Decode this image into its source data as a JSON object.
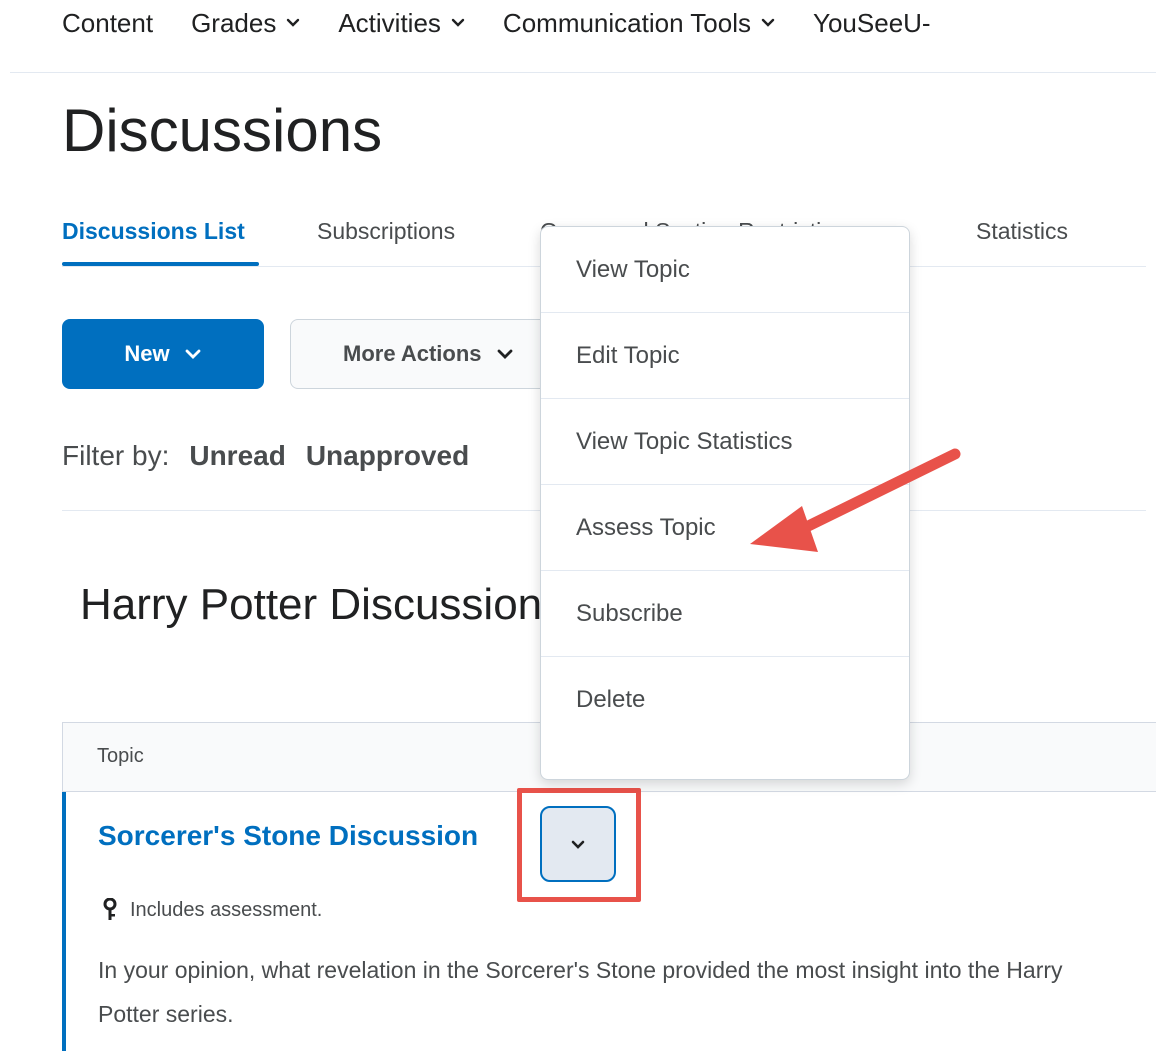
{
  "nav": {
    "items": [
      {
        "label": "Content",
        "dropdown": false
      },
      {
        "label": "Grades",
        "dropdown": true
      },
      {
        "label": "Activities",
        "dropdown": true
      },
      {
        "label": "Communication Tools",
        "dropdown": true
      },
      {
        "label": "YouSeeU-",
        "dropdown": false
      }
    ]
  },
  "page": {
    "title": "Discussions"
  },
  "tabs": [
    {
      "label": "Discussions List",
      "active": true
    },
    {
      "label": "Subscriptions",
      "active": false
    },
    {
      "label": "Group and Section Restrictions",
      "active": false
    },
    {
      "label": "Statistics",
      "active": false
    }
  ],
  "toolbar": {
    "new_label": "New",
    "more_actions_label": "More Actions"
  },
  "filter": {
    "label": "Filter by:",
    "options": [
      "Unread",
      "Unapproved"
    ]
  },
  "forum": {
    "title": "Harry Potter Discussions"
  },
  "table": {
    "column_header": "Topic"
  },
  "topic": {
    "title": "Sorcerer's Stone Discussion",
    "assessment_note": "Includes assessment.",
    "description": "In your opinion, what revelation in the Sorcerer's Stone provided the most insight into the Harry Potter series."
  },
  "context_menu": {
    "items": [
      "View Topic",
      "Edit Topic",
      "View Topic Statistics",
      "Assess Topic",
      "Subscribe",
      "Delete"
    ]
  },
  "colors": {
    "accent": "#006fbf",
    "annotation": "#e8524a"
  }
}
